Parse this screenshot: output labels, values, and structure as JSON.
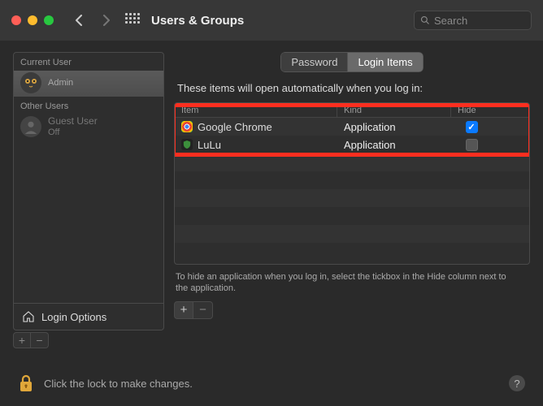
{
  "window": {
    "title": "Users & Groups"
  },
  "search": {
    "placeholder": "Search"
  },
  "sidebar": {
    "current_label": "Current User",
    "other_label": "Other Users",
    "current_user": {
      "name": "",
      "role": "Admin"
    },
    "other_users": [
      {
        "name": "Guest User",
        "status": "Off"
      }
    ],
    "login_options_label": "Login Options"
  },
  "tabs": {
    "password": "Password",
    "login_items": "Login Items"
  },
  "main": {
    "instruction": "These items will open automatically when you log in:",
    "columns": {
      "item": "Item",
      "kind": "Kind",
      "hide": "Hide"
    },
    "rows": [
      {
        "icon": "chrome",
        "name": "Google Chrome",
        "kind": "Application",
        "hide": true
      },
      {
        "icon": "lulu",
        "name": "LuLu",
        "kind": "Application",
        "hide": false
      }
    ],
    "hint": "To hide an application when you log in, select the tickbox in the Hide column next to the application."
  },
  "footer": {
    "lock_text": "Click the lock to make changes."
  }
}
